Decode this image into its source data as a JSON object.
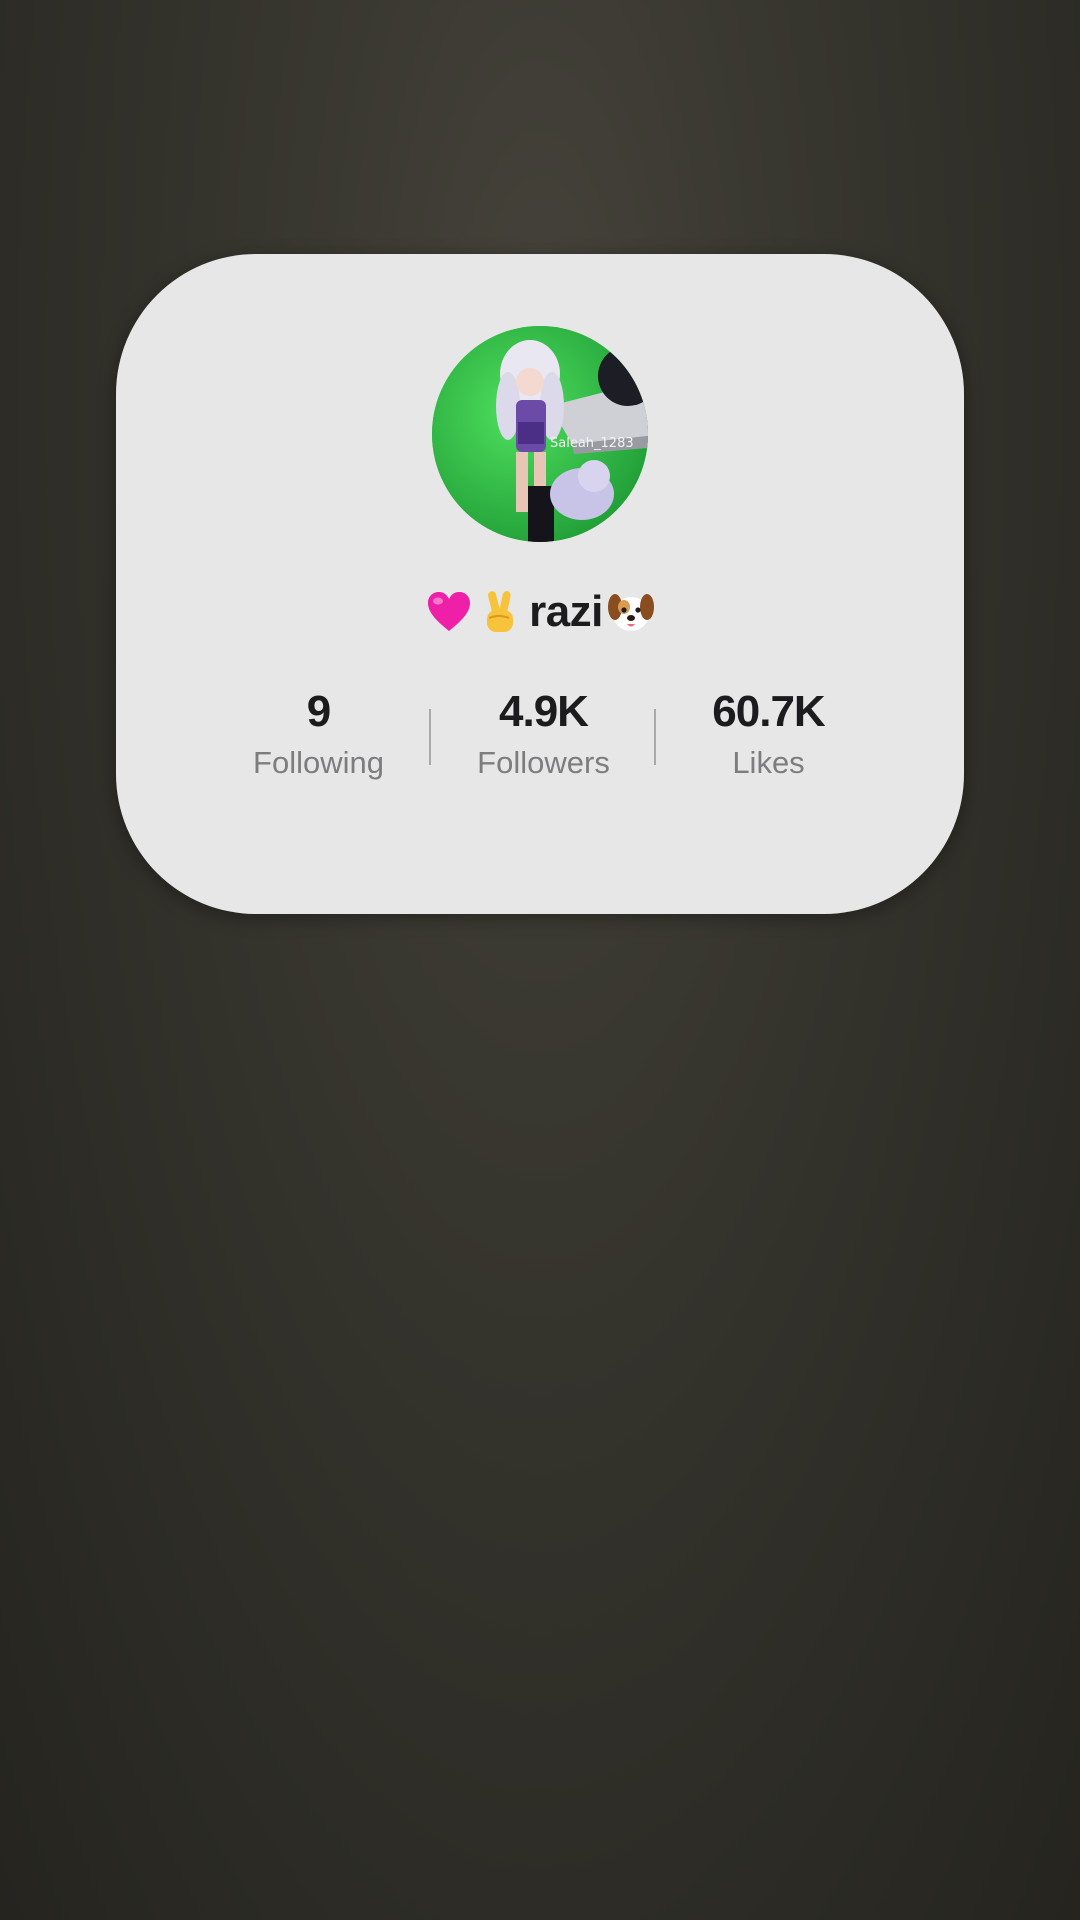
{
  "profile": {
    "avatar_caption": "Saleah_1283",
    "display_name": "razi",
    "name_emojis": [
      "pink-heart-emoji",
      "victory-hand-emoji",
      "dog-face-emoji"
    ]
  },
  "stats": [
    {
      "value": "9",
      "label": "Following"
    },
    {
      "value": "4.9K",
      "label": "Followers"
    },
    {
      "value": "60.7K",
      "label": "Likes"
    }
  ],
  "colors": {
    "card": "#e7e7e8",
    "background": "#34332c",
    "primary_text": "#1c1c1e",
    "secondary_text": "#7d7d80",
    "avatar_green": "#2fbf45"
  }
}
